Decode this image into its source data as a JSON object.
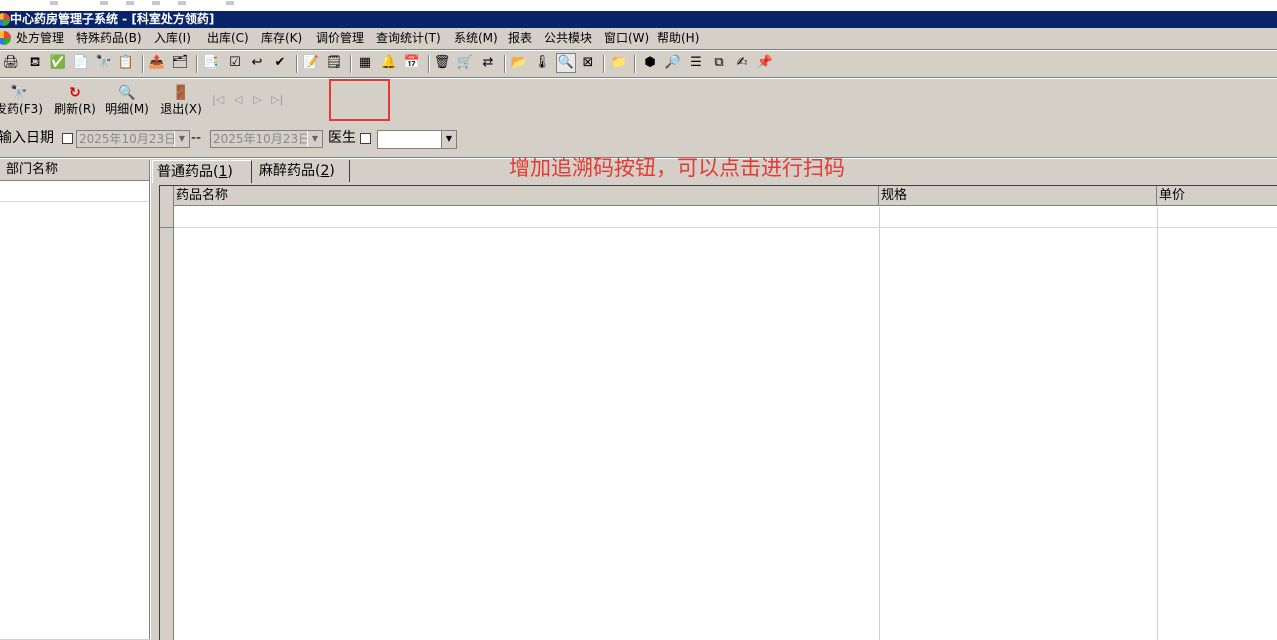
{
  "window": {
    "title": "中心药房管理子系统 - [科室处方领药]"
  },
  "menu": [
    "处方管理",
    "特殊药品(B)",
    "入库(I)",
    "出库(C)",
    "库存(K)",
    "调价管理",
    "查询统计(T)",
    "系统(M)",
    "报表",
    "公共模块",
    "窗口(W)",
    "帮助(H)"
  ],
  "actions": {
    "dispense": "发药(F3)",
    "refresh": "刷新(R)",
    "detail": "明细(M)",
    "exit": "退出(X)"
  },
  "nav_arrows": [
    "|◁",
    "◁",
    "▷",
    "▷|"
  ],
  "filter": {
    "date_label": "输入日期",
    "date_from": "2025年10月23日",
    "separator": "--",
    "date_to": "2025年10月23日",
    "doctor_label": "医生",
    "doctor_value": ""
  },
  "left_panel": {
    "header": "部门名称"
  },
  "tabs": [
    {
      "label": "普通药品",
      "key": "1"
    },
    {
      "label": "麻醉药品",
      "key": "2"
    }
  ],
  "grid": {
    "columns": [
      "药品名称",
      "规格",
      "单价"
    ]
  },
  "annotation": {
    "text": "增加追溯码按钮，可以点击进行扫码",
    "color": "#e53935"
  },
  "colors": {
    "titlebar": "#0a246a",
    "chrome": "#d4d0c8"
  }
}
